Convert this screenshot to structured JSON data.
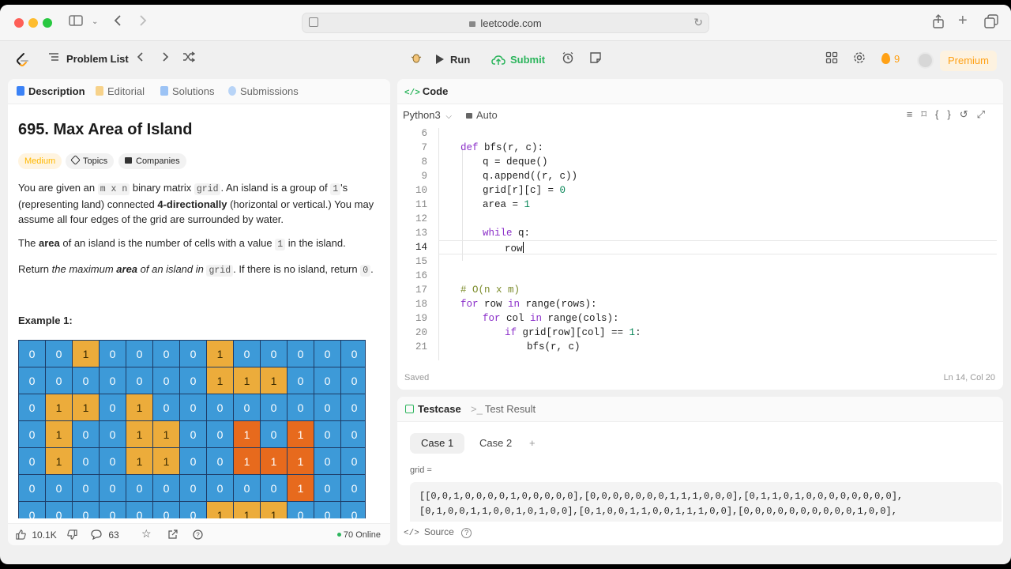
{
  "browser": {
    "url": "leetcode.com"
  },
  "nav": {
    "problem_list": "Problem List",
    "run": "Run",
    "submit": "Submit",
    "streak": "9",
    "premium": "Premium"
  },
  "left_tabs": {
    "description": "Description",
    "editorial": "Editorial",
    "solutions": "Solutions",
    "submissions": "Submissions"
  },
  "problem": {
    "title": "695. Max Area of Island",
    "difficulty": "Medium",
    "topics": "Topics",
    "companies": "Companies",
    "p1_a": "You are given an ",
    "p1_code1": "m x n",
    "p1_b": " binary matrix ",
    "p1_code2": "grid",
    "p1_c": ". An island is a group of ",
    "p1_code3": "1",
    "p1_d": "'s (representing land) connected ",
    "p1_bold": "4-directionally",
    "p1_e": " (horizontal or vertical.) You may assume all four edges of the grid are surrounded by water.",
    "p2_a": "The ",
    "p2_bold": "area",
    "p2_b": " of an island is the number of cells with a value ",
    "p2_code": "1",
    "p2_c": " in the island.",
    "p3_a": "Return ",
    "p3_i1": "the maximum ",
    "p3_bold": "area",
    "p3_i2": " of an island in ",
    "p3_code": "grid",
    "p3_b": ". If there is no island, return ",
    "p3_code2": "0",
    "p3_c": ".",
    "example_title": "Example 1:",
    "grid_rows": [
      [
        0,
        0,
        1,
        0,
        0,
        0,
        0,
        1,
        0,
        0,
        0,
        0,
        0
      ],
      [
        0,
        0,
        0,
        0,
        0,
        0,
        0,
        1,
        1,
        1,
        0,
        0,
        0
      ],
      [
        0,
        1,
        1,
        0,
        1,
        0,
        0,
        0,
        0,
        0,
        0,
        0,
        0
      ],
      [
        0,
        1,
        0,
        0,
        1,
        1,
        0,
        0,
        2,
        0,
        2,
        0,
        0
      ],
      [
        0,
        1,
        0,
        0,
        1,
        1,
        0,
        0,
        2,
        2,
        2,
        0,
        0
      ],
      [
        0,
        0,
        0,
        0,
        0,
        0,
        0,
        0,
        0,
        0,
        2,
        0,
        0
      ],
      [
        0,
        0,
        0,
        0,
        0,
        0,
        0,
        1,
        1,
        1,
        0,
        0,
        0
      ]
    ]
  },
  "left_footer": {
    "likes": "10.1K",
    "comments": "63",
    "online": "70 Online"
  },
  "code_panel": {
    "title": "Code",
    "language": "Python3",
    "mode": "Auto",
    "status": "Saved",
    "position": "Ln 14, Col 20"
  },
  "code_lines": [
    {
      "n": "6",
      "indent": 0,
      "html": ""
    },
    {
      "n": "7",
      "indent": 1,
      "html": "<span class=\"kw\">def</span> bfs(r, c):"
    },
    {
      "n": "8",
      "indent": 2,
      "html": "q = deque()"
    },
    {
      "n": "9",
      "indent": 2,
      "html": "q.append((r, c))"
    },
    {
      "n": "10",
      "indent": 2,
      "html": "grid[r][c] = <span class=\"num\">0</span>"
    },
    {
      "n": "11",
      "indent": 2,
      "html": "area = <span class=\"num\">1</span>"
    },
    {
      "n": "12",
      "indent": 0,
      "html": ""
    },
    {
      "n": "13",
      "indent": 2,
      "html": "<span class=\"kw\">while</span> q:"
    },
    {
      "n": "14",
      "indent": 3,
      "html": "row<span class=\"cursor\"></span>"
    },
    {
      "n": "15",
      "indent": 0,
      "html": ""
    },
    {
      "n": "16",
      "indent": 0,
      "html": ""
    },
    {
      "n": "17",
      "indent": 1,
      "html": "<span class=\"cmt\"># O(n x m)</span>"
    },
    {
      "n": "18",
      "indent": 1,
      "html": "<span class=\"kw\">for</span> row <span class=\"kw\">in</span> range(rows):"
    },
    {
      "n": "19",
      "indent": 2,
      "html": "<span class=\"kw\">for</span> col <span class=\"kw\">in</span> range(cols):"
    },
    {
      "n": "20",
      "indent": 3,
      "html": "<span class=\"kw\">if</span> grid[row][col] == <span class=\"num\">1</span>:"
    },
    {
      "n": "21",
      "indent": 4,
      "html": "bfs(r, c)"
    }
  ],
  "test_panel": {
    "testcase": "Testcase",
    "test_result": "Test Result",
    "case1": "Case 1",
    "case2": "Case 2",
    "add": "+",
    "grid_label": "grid =",
    "input_line1": "[[0,0,1,0,0,0,0,1,0,0,0,0,0],[0,0,0,0,0,0,0,1,1,1,0,0,0],[0,1,1,0,1,0,0,0,0,0,0,0,0],",
    "input_line2": "[0,1,0,0,1,1,0,0,1,0,1,0,0],[0,1,0,0,1,1,0,0,1,1,1,0,0],[0,0,0,0,0,0,0,0,0,0,1,0,0],",
    "source": "Source"
  }
}
